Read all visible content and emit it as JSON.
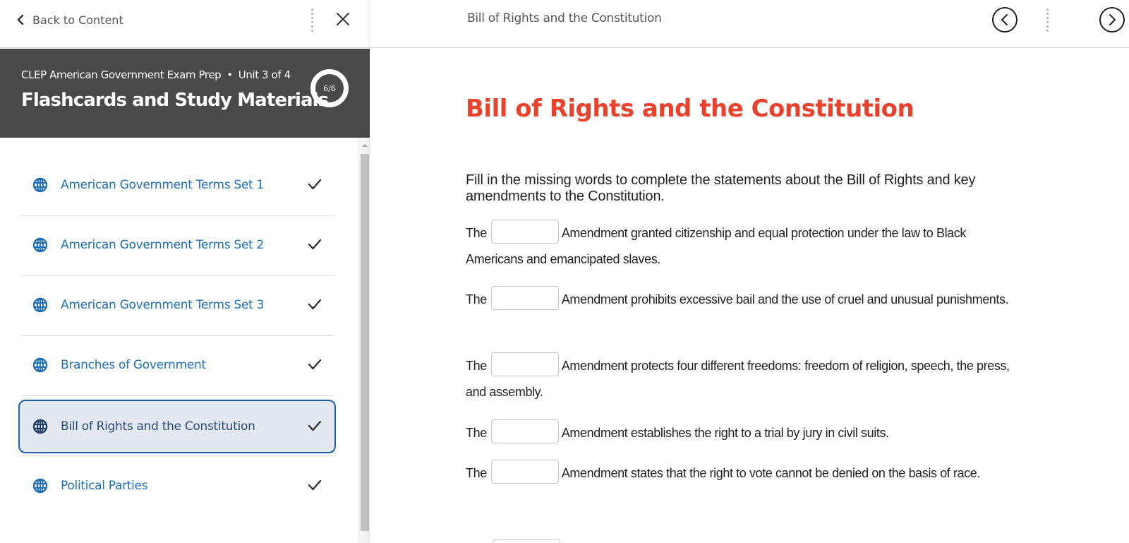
{
  "topbar_left": {
    "back_label": "Back to Content",
    "back_icon": "chevron-left-icon",
    "menu_icon": "kebab-icon",
    "close_icon": "close-icon"
  },
  "unit_header": {
    "course": "CLEP American Government Exam Prep",
    "separator": "•",
    "unit": "Unit 3 of 4",
    "title": "Flashcards and Study Materials",
    "progress_text": "6/6",
    "progress_completed": 6,
    "progress_total": 6
  },
  "sidebar": {
    "items": [
      {
        "label": "American Government Terms Set 1",
        "icon": "globe-icon",
        "completed": true,
        "active": false
      },
      {
        "label": "American Government Terms Set 2",
        "icon": "globe-icon",
        "completed": true,
        "active": false
      },
      {
        "label": "American Government Terms Set 3",
        "icon": "globe-icon",
        "completed": true,
        "active": false
      },
      {
        "label": "Branches of Government",
        "icon": "globe-icon",
        "completed": true,
        "active": false
      },
      {
        "label": "Bill of Rights and the Constitution",
        "icon": "globe-icon",
        "completed": true,
        "active": true
      },
      {
        "label": "Political Parties",
        "icon": "globe-icon",
        "completed": true,
        "active": false
      }
    ]
  },
  "topbar_right": {
    "title": "Bill of Rights and the Constitution",
    "prev_icon": "chevron-left-circle-icon",
    "next_icon": "chevron-right-circle-icon"
  },
  "content": {
    "title": "Bill of Rights and the Constitution",
    "title_color": "#e8412c",
    "instructions": "Fill in the missing words to complete the statements about the Bill of Rights and key amendments to the Constitution.",
    "questions": [
      {
        "prefix": "The",
        "value": "",
        "suffix": "Amendment granted citizenship and equal protection under the law to Black Americans and emancipated slaves."
      },
      {
        "prefix": "The",
        "value": "",
        "suffix": "Amendment prohibits excessive bail and the use of cruel and unusual punishments."
      },
      {
        "prefix": "The",
        "value": "",
        "suffix": "Amendment protects four different freedoms: freedom of religion, speech, the press, and assembly."
      },
      {
        "prefix": "The",
        "value": "",
        "suffix": "Amendment establishes the right to a trial by jury in civil suits."
      },
      {
        "prefix": "The",
        "value": "",
        "suffix": "Amendment states that the right to vote cannot be denied on the basis of race."
      }
    ]
  },
  "colors": {
    "link_blue": "#1f6fb5",
    "header_bg": "#494949",
    "active_bg": "#e3e8f0",
    "active_border": "#1f5fa8"
  }
}
